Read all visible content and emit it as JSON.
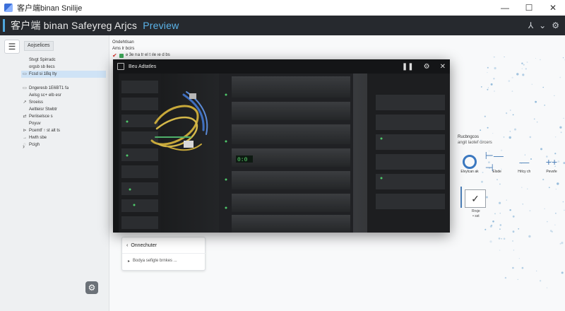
{
  "window": {
    "title": "客户端binan Snilije",
    "controls": {
      "minimize": "—",
      "maximize": "☐",
      "close": "✕"
    }
  },
  "header": {
    "title_main": "客户端 binan Safeyreg Arjcs",
    "title_accent": "Preview",
    "right_icon_1": "⅄",
    "right_chevron": "⌄",
    "right_icon_2": "⚙"
  },
  "sidebar": {
    "toggle_icon": "☰",
    "tab_label": "Aojselices",
    "items": [
      {
        "icon": "",
        "label": "Stvgt Spirradc"
      },
      {
        "icon": "",
        "label": "orgsb sb llecs"
      },
      {
        "icon": "▭",
        "label": "Fcsd si 1Bq Ity",
        "active": true
      },
      {
        "icon": "",
        "label": ""
      },
      {
        "icon": "▭",
        "label": "Dngeresb 1E6BT1 fa"
      },
      {
        "icon": "",
        "label": "Aelsg sc+ elb esr"
      },
      {
        "icon": "↗",
        "label": "Sroeiss"
      },
      {
        "icon": "",
        "label": "Aeltleisr Stwbtr"
      },
      {
        "icon": "⇄",
        "label": "Periiselsce s"
      },
      {
        "icon": "",
        "label": "Poyuv"
      },
      {
        "icon": "⊳",
        "label": "Pcemtf  ↑ st alt ts"
      },
      {
        "icon": "→",
        "label": "Hwth sbe"
      },
      {
        "icon": "◌",
        "label": "Pcigh"
      }
    ],
    "expand_icon": "›",
    "settings_icon": "⚙"
  },
  "main": {
    "head_title": "Ondehtlsan",
    "head_sub": "Ams lr bcirs",
    "head_row": "ǝ 3e rıa tr el t ıle ıe d bs",
    "right_panel": {
      "title": "Rucbngcos",
      "subtitle": "angit laotef circers",
      "tools": [
        {
          "icon": "ring",
          "label": "Elvylcan ak"
        },
        {
          "icon": "⊢—⊣",
          "label": "Elsde"
        },
        {
          "icon": "—",
          "label": "Hrlcy ch"
        },
        {
          "icon": "++",
          "label": "Pevsfe"
        }
      ],
      "check_icon": "✓",
      "check_caption_1": "Rrsje",
      "check_caption_2": "• sst"
    },
    "back_card": {
      "back_icon": "‹",
      "back_label": "Onnechuter",
      "sub_bullet": "▸",
      "sub_label": "Bodya  sefigte brnkes ..."
    }
  },
  "preview": {
    "title": "Beu Adtatles",
    "actions": {
      "pause": "❚❚",
      "settings": "⚙",
      "close": "✕"
    }
  }
}
